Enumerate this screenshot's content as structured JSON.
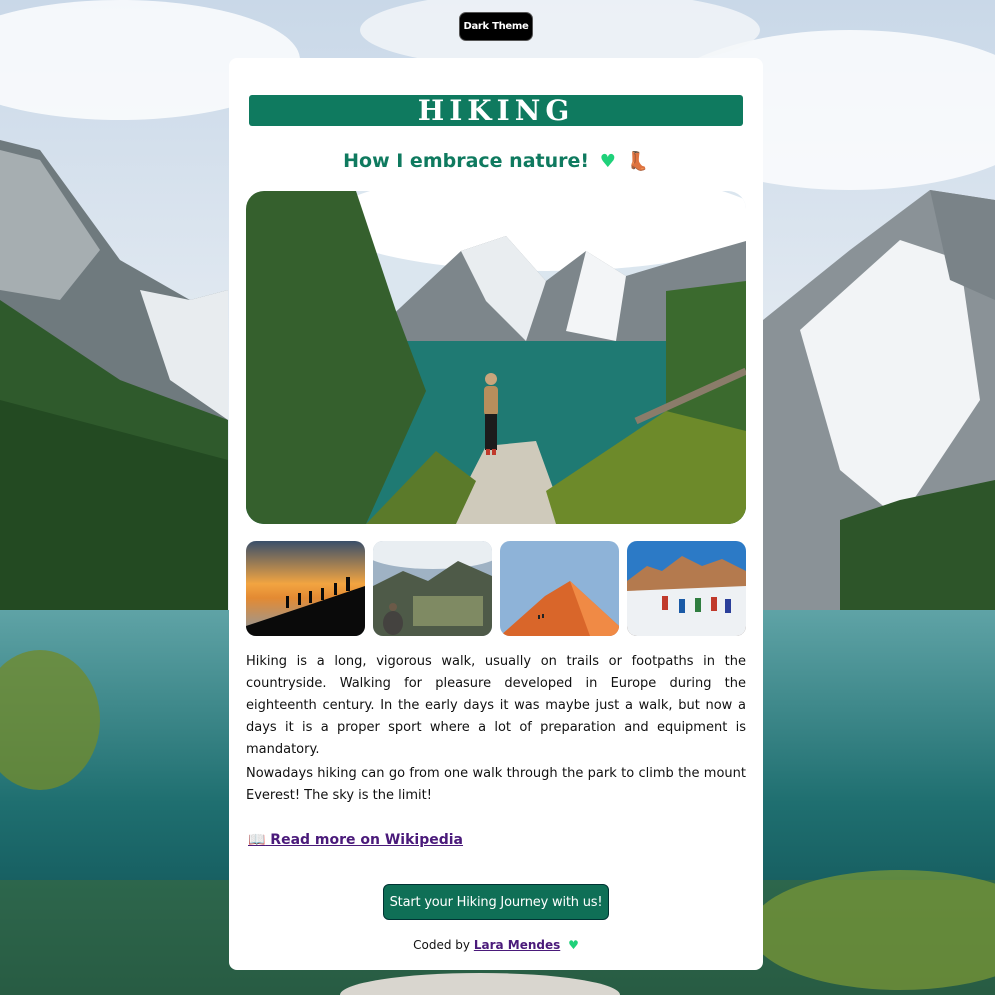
{
  "theme_toggle": {
    "label": "Dark Theme"
  },
  "header": {
    "title": "HIKING",
    "subtitle": "How I embrace nature!",
    "subtitle_icons": [
      "green-heart-icon",
      "hiking-boot-icon"
    ]
  },
  "images": {
    "hero": "hiker-at-alpine-lake",
    "thumbnails": [
      "hikers-at-sunset",
      "mountain-ruins-view",
      "desert-sand-dune",
      "hikers-in-snow"
    ]
  },
  "content": {
    "paragraph1": "Hiking is a long, vigorous walk, usually on trails or footpaths in the countryside. Walking for pleasure developed in Europe during the eighteenth century. In the early days it was maybe just a walk, but now a days it is a proper sport where a lot of preparation and equipment is mandatory.",
    "paragraph2": "Nowadays hiking can go from one walk through the park to climb the mount Everest! The sky is the limit!",
    "wiki_link": " Read more on Wikipedia",
    "wiki_icon": "open-book-icon"
  },
  "cta": {
    "label": "Start your Hiking Journey with us!"
  },
  "footer": {
    "prefix": "Coded by",
    "author": "Lara Mendes"
  },
  "colors": {
    "accent": "#0f7a5f",
    "link": "#4a1a7a",
    "heart": "#1fd17a"
  }
}
